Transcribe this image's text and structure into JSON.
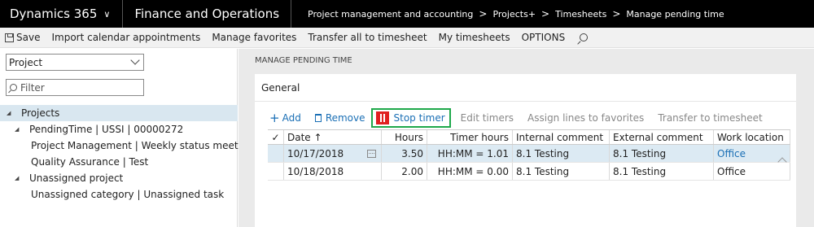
{
  "topbar": {
    "app_title": "Dynamics 365",
    "module_title": "Finance and Operations",
    "breadcrumbs": [
      "Project management and accounting",
      "Projects+",
      "Timesheets",
      "Manage pending time"
    ]
  },
  "actionbar": {
    "save": "Save",
    "import": "Import calendar appointments",
    "favorites": "Manage favorites",
    "transfer_all": "Transfer all to timesheet",
    "my_timesheets": "My timesheets",
    "options": "OPTIONS"
  },
  "left": {
    "select_value": "Project",
    "filter_placeholder": "Filter",
    "tree": [
      {
        "label": "Projects",
        "level": 0,
        "expanded": true,
        "selected": true
      },
      {
        "label": "PendingTime | USSI | 00000272",
        "level": 1,
        "expanded": true,
        "selected": false
      },
      {
        "label": "Project Management | Weekly status meeting",
        "level": 2,
        "selected": false
      },
      {
        "label": "Quality Assurance | Test",
        "level": 2,
        "selected": false
      },
      {
        "label": "Unassigned project",
        "level": 1,
        "expanded": true,
        "selected": false
      },
      {
        "label": "Unassigned category | Unassigned task",
        "level": 2,
        "selected": false
      }
    ]
  },
  "main": {
    "caption": "MANAGE PENDING TIME",
    "card_title": "General",
    "toolbar": {
      "add": "Add",
      "remove": "Remove",
      "stop_timer": "Stop timer",
      "edit_timers": "Edit timers",
      "assign_favorites": "Assign lines to favorites",
      "transfer": "Transfer to timesheet"
    },
    "columns": [
      "Date",
      "Hours",
      "Timer hours",
      "Internal comment",
      "External comment",
      "Work location"
    ],
    "date_sort_arrow": "↑",
    "rows": [
      {
        "date": "10/17/2018",
        "hours": "3.50",
        "timer": "HH:MM = 1.01",
        "internal": "8.1 Testing",
        "external": "8.1 Testing",
        "location": "Office",
        "active": true
      },
      {
        "date": "10/18/2018",
        "hours": "2.00",
        "timer": "HH:MM = 0.00",
        "internal": "8.1 Testing",
        "external": "8.1 Testing",
        "location": "Office",
        "active": false
      }
    ]
  },
  "colors": {
    "topbar": "#000000",
    "accent": "#1a6fb5",
    "stop_red": "#e02020",
    "highlight_green": "#1ea84a",
    "selected_row": "#dceaf3"
  }
}
